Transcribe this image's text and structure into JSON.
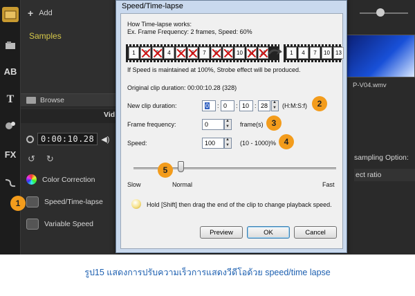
{
  "background_app": {
    "library": {
      "add_label": "Add",
      "samples_label": "Samples",
      "browse_label": "Browse"
    },
    "timecode": "0:00:10.28",
    "video_tab_label": "Vid",
    "tools": [
      {
        "label": "Color Correction",
        "icon": "color-wheel-icon"
      },
      {
        "label": "Speed/Time-lapse",
        "icon": "speed-icon"
      },
      {
        "label": "Variable Speed",
        "icon": "variable-speed-icon"
      }
    ],
    "thumbnail_label": "P-V04.wmv",
    "resampling_label": "sampling Option:",
    "aspect_label": "ect ratio",
    "sidebar_icons": [
      "media-icon",
      "instant-project-icon",
      "title-ab-icon",
      "text-t-icon",
      "transition-icon",
      "fx-icon",
      "path-icon"
    ]
  },
  "dialog": {
    "title": "Speed/Time-lapse",
    "how_title": "How Time-lapse works:",
    "example": "Ex. Frame Frequency: 2 frames, Speed: 60%",
    "frames_before": [
      "1",
      "2",
      "3",
      "4",
      "5",
      "6",
      "7",
      "8",
      "9",
      "10",
      "11",
      "12"
    ],
    "frames_struck": [
      "2",
      "3",
      "5",
      "6",
      "8",
      "9",
      "11",
      "12"
    ],
    "frames_after": [
      "1",
      "4",
      "7",
      "10",
      "13"
    ],
    "strobe_note": "If Speed is maintained at 100%, Strobe effect will be produced.",
    "original_duration": "Original clip duration: 00:00:10.28 (328)",
    "new_duration_label": "New clip duration:",
    "new_duration_fields": [
      "0",
      "0",
      "10",
      "28"
    ],
    "duration_format": "(H:M:S:f)",
    "frame_frequency_label": "Frame frequency:",
    "frame_frequency_value": "0",
    "frame_unit": "frame(s)",
    "speed_label": "Speed:",
    "speed_value": "100",
    "speed_range": "(10 - 1000)%",
    "slider_slow": "Slow",
    "slider_normal": "Normal",
    "slider_fast": "Fast",
    "slider_level_percent": 23,
    "hint": "Hold [Shift] then drag the end of the clip to change playback speed.",
    "preview_label": "Preview",
    "ok_label": "OK",
    "cancel_label": "Cancel"
  },
  "callouts": [
    "1",
    "2",
    "3",
    "4",
    "5"
  ],
  "caption": "รูป15 แสดงการปรับความเร็วการแสดงวีดีโอด้วย speed/time lapse",
  "colors": {
    "callout": "#f39c1c",
    "caption": "#1c5fb0",
    "samples": "#d6c84a",
    "dialog_frame": "#c9d9ee"
  }
}
